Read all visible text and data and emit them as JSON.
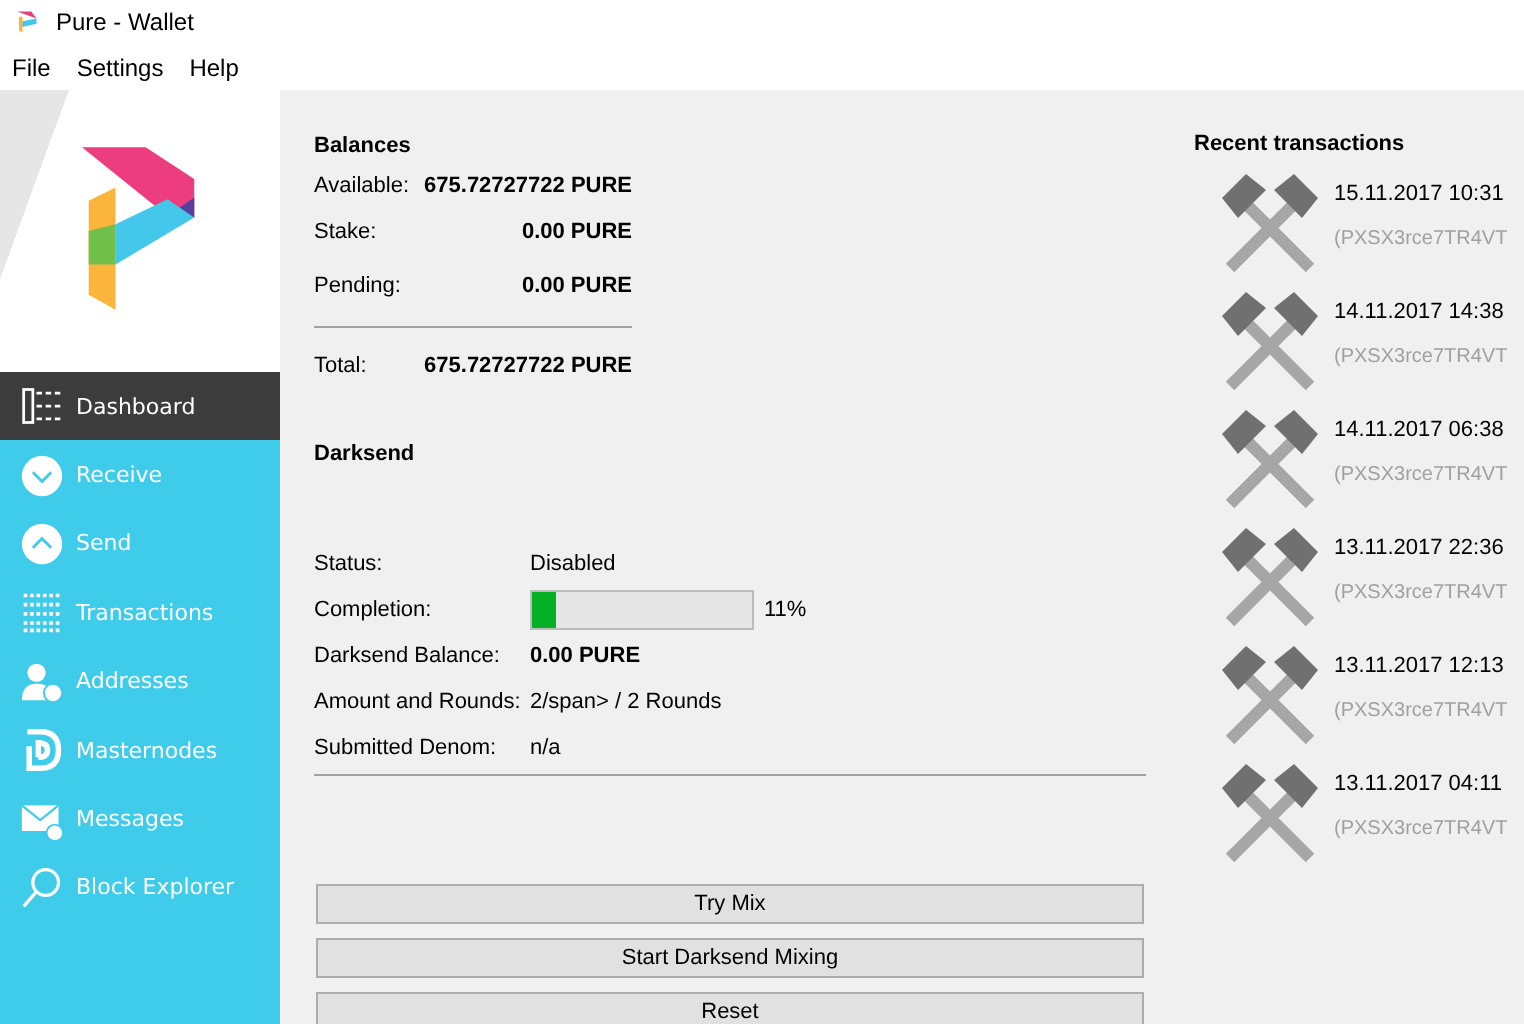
{
  "window": {
    "title": "Pure - Wallet"
  },
  "menu": [
    "File",
    "Settings",
    "Help"
  ],
  "sidebar": {
    "items": [
      {
        "label": "Dashboard",
        "kind": "dashboard",
        "selected": true
      },
      {
        "label": "Receive",
        "kind": "receive",
        "selected": false
      },
      {
        "label": "Send",
        "kind": "send",
        "selected": false
      },
      {
        "label": "Transactions",
        "kind": "transactions",
        "selected": false
      },
      {
        "label": "Addresses",
        "kind": "addresses",
        "selected": false
      },
      {
        "label": "Masternodes",
        "kind": "masternodes",
        "selected": false
      },
      {
        "label": "Messages",
        "kind": "messages",
        "selected": false
      },
      {
        "label": "Block Explorer",
        "kind": "explorer",
        "selected": false
      }
    ]
  },
  "balances": {
    "title": "Balances",
    "rows": [
      {
        "label": "Available:",
        "value": "675.72727722 PURE"
      },
      {
        "label": "Stake:",
        "value": "0.00 PURE"
      },
      {
        "label": "Pending:",
        "value": "0.00 PURE"
      }
    ],
    "total": {
      "label": "Total:",
      "value": "675.72727722 PURE"
    }
  },
  "darksend": {
    "title": "Darksend",
    "status": {
      "label": "Status:",
      "value": "Disabled"
    },
    "completion": {
      "label": "Completion:",
      "level": 0.11,
      "reading": "11%"
    },
    "rows": [
      {
        "label": "Darksend Balance:",
        "value": "0.00 PURE",
        "bold": true
      },
      {
        "label": "Amount and Rounds:",
        "value": "2/span> / 2 Rounds",
        "bold": false
      },
      {
        "label": "Submitted Denom:",
        "value": "n/a",
        "bold": false
      }
    ],
    "buttons": [
      "Try Mix",
      "Start Darksend Mixing",
      "Reset"
    ]
  },
  "recent": {
    "title": "Recent transactions",
    "items": [
      {
        "date": "15.11.2017 10:31",
        "address": "(PXSX3rce7TR4VT"
      },
      {
        "date": "14.11.2017 14:38",
        "address": "(PXSX3rce7TR4VT"
      },
      {
        "date": "14.11.2017 06:38",
        "address": "(PXSX3rce7TR4VT"
      },
      {
        "date": "13.11.2017 22:36",
        "address": "(PXSX3rce7TR4VT"
      },
      {
        "date": "13.11.2017 12:13",
        "address": "(PXSX3rce7TR4VT"
      },
      {
        "date": "13.11.2017 04:11",
        "address": "(PXSX3rce7TR4VT"
      }
    ]
  }
}
